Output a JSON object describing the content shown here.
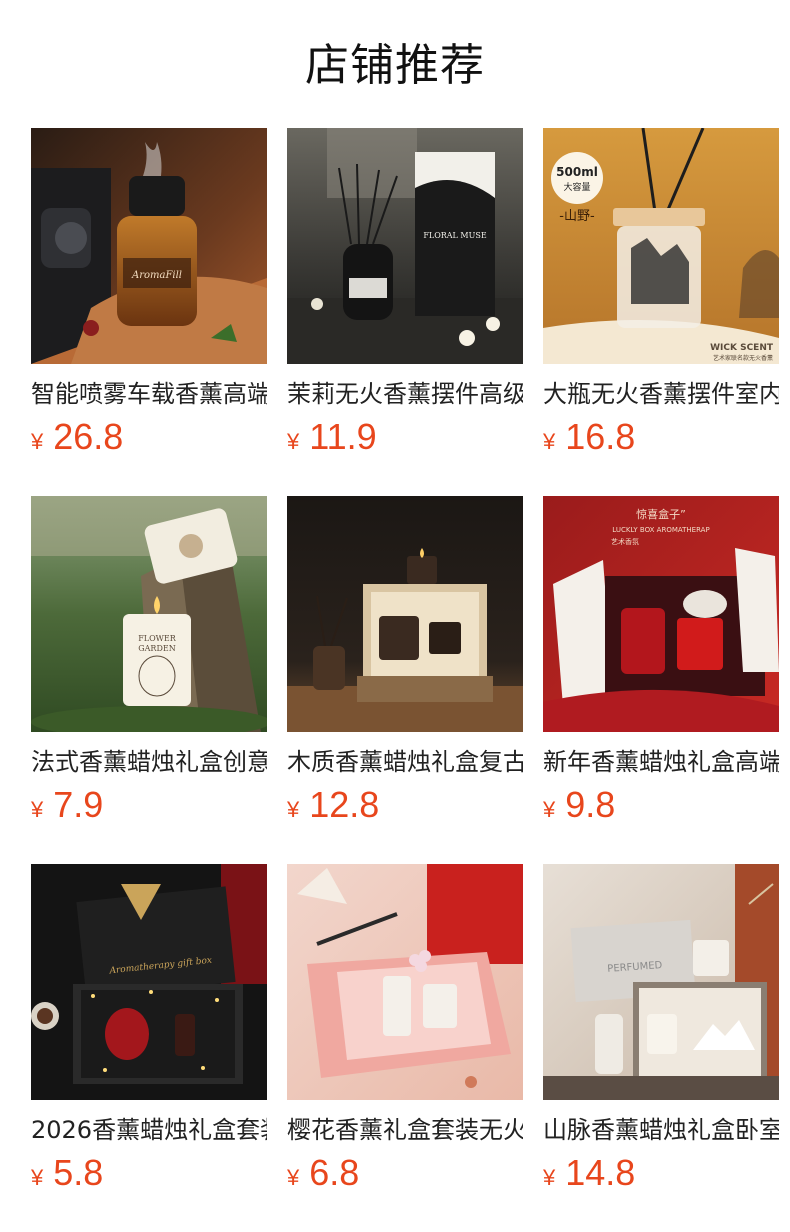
{
  "header": {
    "title": "店铺推荐"
  },
  "currency_symbol": "¥",
  "colors": {
    "price": "#e8461c",
    "title": "#111111",
    "name": "#222222"
  },
  "products": [
    {
      "name": "智能喷雾车载香薰高端",
      "price": "26.8",
      "image_text": [
        "AromaFill"
      ]
    },
    {
      "name": "茉莉无火香薰摆件高级",
      "price": "11.9",
      "image_text": [
        "FLORAL MUSE"
      ]
    },
    {
      "name": "大瓶无火香薰摆件室内",
      "price": "16.8",
      "image_text": [
        "500ml",
        "大容量",
        "-山野-",
        "WICK SCENT",
        "艺术家联名款无火香薰"
      ]
    },
    {
      "name": "法式香薰蜡烛礼盒创意",
      "price": "7.9",
      "image_text": [
        "FLOWER",
        "GARDEN"
      ]
    },
    {
      "name": "木质香薰蜡烛礼盒复古",
      "price": "12.8",
      "image_text": []
    },
    {
      "name": "新年香薰蜡烛礼盒高端",
      "price": "9.8",
      "image_text": [
        "惊喜盒子”",
        "LUCKLY BOX AROMATHERAP",
        "艺术香氛"
      ]
    },
    {
      "name": "2026香薰蜡烛礼盒套装",
      "price": "5.8",
      "image_text": [
        "Aromatherapy gift box"
      ]
    },
    {
      "name": "樱花香薰礼盒套装无火",
      "price": "6.8",
      "image_text": []
    },
    {
      "name": "山脉香薰蜡烛礼盒卧室",
      "price": "14.8",
      "image_text": [
        "PERFUMED"
      ]
    }
  ]
}
